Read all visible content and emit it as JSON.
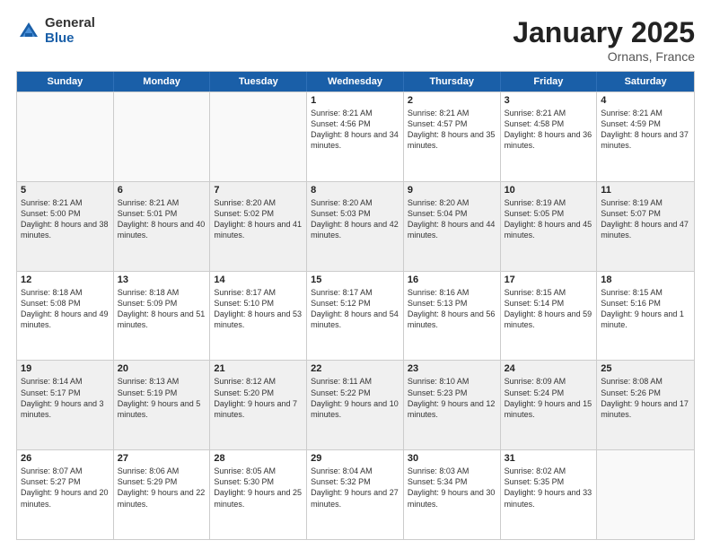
{
  "logo": {
    "general": "General",
    "blue": "Blue"
  },
  "title": "January 2025",
  "location": "Ornans, France",
  "days": [
    "Sunday",
    "Monday",
    "Tuesday",
    "Wednesday",
    "Thursday",
    "Friday",
    "Saturday"
  ],
  "rows": [
    [
      {
        "day": "",
        "empty": true
      },
      {
        "day": "",
        "empty": true
      },
      {
        "day": "",
        "empty": true
      },
      {
        "day": "1",
        "sunrise": "8:21 AM",
        "sunset": "4:56 PM",
        "daylight": "8 hours and 34 minutes."
      },
      {
        "day": "2",
        "sunrise": "8:21 AM",
        "sunset": "4:57 PM",
        "daylight": "8 hours and 35 minutes."
      },
      {
        "day": "3",
        "sunrise": "8:21 AM",
        "sunset": "4:58 PM",
        "daylight": "8 hours and 36 minutes."
      },
      {
        "day": "4",
        "sunrise": "8:21 AM",
        "sunset": "4:59 PM",
        "daylight": "8 hours and 37 minutes."
      }
    ],
    [
      {
        "day": "5",
        "sunrise": "8:21 AM",
        "sunset": "5:00 PM",
        "daylight": "8 hours and 38 minutes."
      },
      {
        "day": "6",
        "sunrise": "8:21 AM",
        "sunset": "5:01 PM",
        "daylight": "8 hours and 40 minutes."
      },
      {
        "day": "7",
        "sunrise": "8:20 AM",
        "sunset": "5:02 PM",
        "daylight": "8 hours and 41 minutes."
      },
      {
        "day": "8",
        "sunrise": "8:20 AM",
        "sunset": "5:03 PM",
        "daylight": "8 hours and 42 minutes."
      },
      {
        "day": "9",
        "sunrise": "8:20 AM",
        "sunset": "5:04 PM",
        "daylight": "8 hours and 44 minutes."
      },
      {
        "day": "10",
        "sunrise": "8:19 AM",
        "sunset": "5:05 PM",
        "daylight": "8 hours and 45 minutes."
      },
      {
        "day": "11",
        "sunrise": "8:19 AM",
        "sunset": "5:07 PM",
        "daylight": "8 hours and 47 minutes."
      }
    ],
    [
      {
        "day": "12",
        "sunrise": "8:18 AM",
        "sunset": "5:08 PM",
        "daylight": "8 hours and 49 minutes."
      },
      {
        "day": "13",
        "sunrise": "8:18 AM",
        "sunset": "5:09 PM",
        "daylight": "8 hours and 51 minutes."
      },
      {
        "day": "14",
        "sunrise": "8:17 AM",
        "sunset": "5:10 PM",
        "daylight": "8 hours and 53 minutes."
      },
      {
        "day": "15",
        "sunrise": "8:17 AM",
        "sunset": "5:12 PM",
        "daylight": "8 hours and 54 minutes."
      },
      {
        "day": "16",
        "sunrise": "8:16 AM",
        "sunset": "5:13 PM",
        "daylight": "8 hours and 56 minutes."
      },
      {
        "day": "17",
        "sunrise": "8:15 AM",
        "sunset": "5:14 PM",
        "daylight": "8 hours and 59 minutes."
      },
      {
        "day": "18",
        "sunrise": "8:15 AM",
        "sunset": "5:16 PM",
        "daylight": "9 hours and 1 minute."
      }
    ],
    [
      {
        "day": "19",
        "sunrise": "8:14 AM",
        "sunset": "5:17 PM",
        "daylight": "9 hours and 3 minutes."
      },
      {
        "day": "20",
        "sunrise": "8:13 AM",
        "sunset": "5:19 PM",
        "daylight": "9 hours and 5 minutes."
      },
      {
        "day": "21",
        "sunrise": "8:12 AM",
        "sunset": "5:20 PM",
        "daylight": "9 hours and 7 minutes."
      },
      {
        "day": "22",
        "sunrise": "8:11 AM",
        "sunset": "5:22 PM",
        "daylight": "9 hours and 10 minutes."
      },
      {
        "day": "23",
        "sunrise": "8:10 AM",
        "sunset": "5:23 PM",
        "daylight": "9 hours and 12 minutes."
      },
      {
        "day": "24",
        "sunrise": "8:09 AM",
        "sunset": "5:24 PM",
        "daylight": "9 hours and 15 minutes."
      },
      {
        "day": "25",
        "sunrise": "8:08 AM",
        "sunset": "5:26 PM",
        "daylight": "9 hours and 17 minutes."
      }
    ],
    [
      {
        "day": "26",
        "sunrise": "8:07 AM",
        "sunset": "5:27 PM",
        "daylight": "9 hours and 20 minutes."
      },
      {
        "day": "27",
        "sunrise": "8:06 AM",
        "sunset": "5:29 PM",
        "daylight": "9 hours and 22 minutes."
      },
      {
        "day": "28",
        "sunrise": "8:05 AM",
        "sunset": "5:30 PM",
        "daylight": "9 hours and 25 minutes."
      },
      {
        "day": "29",
        "sunrise": "8:04 AM",
        "sunset": "5:32 PM",
        "daylight": "9 hours and 27 minutes."
      },
      {
        "day": "30",
        "sunrise": "8:03 AM",
        "sunset": "5:34 PM",
        "daylight": "9 hours and 30 minutes."
      },
      {
        "day": "31",
        "sunrise": "8:02 AM",
        "sunset": "5:35 PM",
        "daylight": "9 hours and 33 minutes."
      },
      {
        "day": "",
        "empty": true
      }
    ]
  ]
}
